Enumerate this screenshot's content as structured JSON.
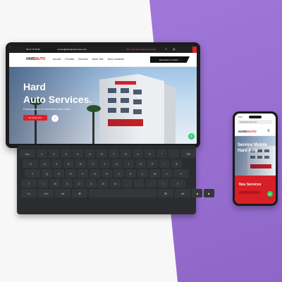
{
  "tablet_site": {
    "topbar": {
      "phone": "05 22 75 58 56",
      "email": "contact@hardautoservices.com",
      "promo": "Offre spéciale diagnostic gratuit",
      "fb_icon": "facebook-icon",
      "ig_icon": "instagram-icon"
    },
    "logo": {
      "part1": "HARD",
      "part2": "AUTO"
    },
    "nav": [
      "Accueil",
      "Produits",
      "Services",
      "Notre Ville",
      "Nous contacter"
    ],
    "cta": "Demandez un devis →",
    "hero": {
      "title_line1": "Hard",
      "title_line2": "Auto Services.",
      "subtitle": "Pneumatique et l'entretien automobile",
      "button": "En savoir plus",
      "arrow": "›"
    },
    "whatsapp_icon": "whatsapp-icon"
  },
  "keyboard": {
    "rows": [
      [
        "esc",
        "1",
        "2",
        "3",
        "4",
        "5",
        "6",
        "7",
        "8",
        "9",
        "0",
        "°",
        "-",
        "⌫"
      ],
      [
        "⇥",
        "A",
        "Z",
        "E",
        "R",
        "T",
        "Y",
        "U",
        "I",
        "O",
        "P",
        "^",
        "$"
      ],
      [
        "⇪",
        "Q",
        "S",
        "D",
        "F",
        "G",
        "H",
        "J",
        "K",
        "L",
        "M",
        "ù",
        "↵"
      ],
      [
        "⇧",
        "<",
        "W",
        "X",
        "C",
        "V",
        "B",
        "N",
        ",",
        ";",
        ":",
        "=",
        "⇧"
      ],
      [
        "fn",
        "ctrl",
        "alt",
        "⌘",
        "",
        "⌘",
        "alt",
        "◀",
        "▶"
      ]
    ]
  },
  "phone_site": {
    "status_time": "9:41",
    "url": "hardautoservices.com",
    "logo": {
      "part1": "HARD",
      "part2": "AUTO"
    },
    "menu_icon": "≡",
    "hero": {
      "line1": "Service Mobile",
      "line2": "Hard Auto"
    },
    "section_title": "Nos Services",
    "whatsapp_icon": "whatsapp-icon"
  },
  "colors": {
    "accent_red": "#e21e26",
    "background_purple": "#9b6fd9",
    "background_white": "#f7f7f8",
    "device_dark": "#1b1c1e"
  }
}
